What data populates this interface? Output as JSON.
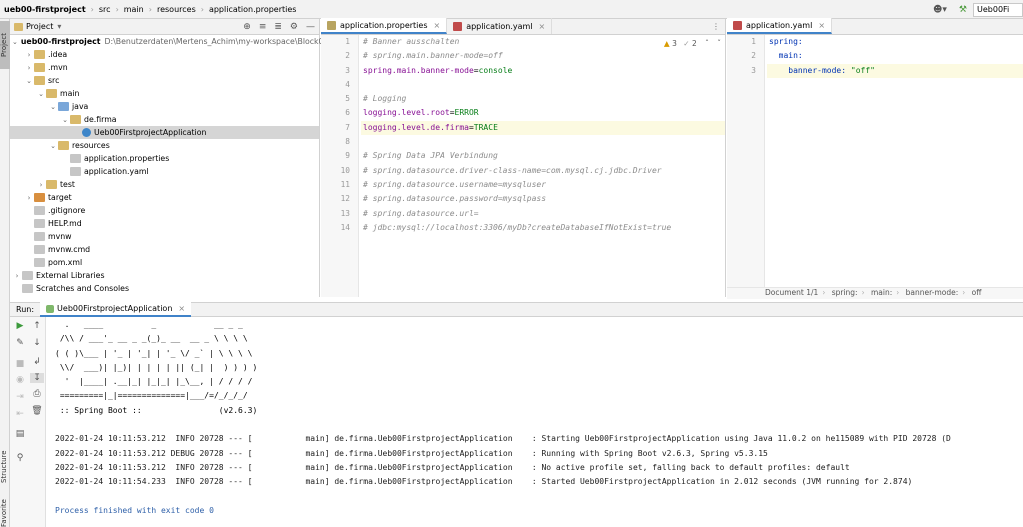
{
  "topbar": {
    "breadcrumbs": [
      "ueb00-firstproject",
      "src",
      "main",
      "resources",
      "application.properties"
    ],
    "run_config": "Ueb00Fi",
    "colors": {
      "accent": "#4083c9"
    }
  },
  "left_strip": {
    "tabs": [
      "Project",
      "Structure",
      "Favorites"
    ]
  },
  "project_panel": {
    "title": "Project",
    "tree": [
      {
        "label": "ueb00-firstproject",
        "path": "D:\\Benutzerdaten\\Mertens_Achim\\my-workspace\\Block07\\ue",
        "icon": "folder",
        "depth": 0,
        "expanded": true
      },
      {
        "label": ".idea",
        "icon": "folder",
        "depth": 1,
        "expanded": false
      },
      {
        "label": ".mvn",
        "icon": "folder",
        "depth": 1,
        "expanded": false
      },
      {
        "label": "src",
        "icon": "folder",
        "depth": 1,
        "expanded": true
      },
      {
        "label": "main",
        "icon": "folder",
        "depth": 2,
        "expanded": true
      },
      {
        "label": "java",
        "icon": "folder-blue",
        "depth": 3,
        "expanded": true
      },
      {
        "label": "de.firma",
        "icon": "folder",
        "depth": 4,
        "expanded": true
      },
      {
        "label": "Ueb00FirstprojectApplication",
        "icon": "class",
        "depth": 5,
        "selected": true
      },
      {
        "label": "resources",
        "icon": "folder",
        "depth": 3,
        "expanded": true
      },
      {
        "label": "application.properties",
        "icon": "file",
        "depth": 4
      },
      {
        "label": "application.yaml",
        "icon": "file",
        "depth": 4
      },
      {
        "label": "test",
        "icon": "folder",
        "depth": 2,
        "expanded": false
      },
      {
        "label": "target",
        "icon": "folder-orange",
        "depth": 1,
        "expanded": false
      },
      {
        "label": ".gitignore",
        "icon": "file",
        "depth": 1
      },
      {
        "label": "HELP.md",
        "icon": "file",
        "depth": 1
      },
      {
        "label": "mvnw",
        "icon": "file",
        "depth": 1
      },
      {
        "label": "mvnw.cmd",
        "icon": "file",
        "depth": 1
      },
      {
        "label": "pom.xml",
        "icon": "file",
        "depth": 1
      },
      {
        "label": "External Libraries",
        "icon": "lib",
        "depth": 0,
        "expanded": false
      },
      {
        "label": "Scratches and Consoles",
        "icon": "scratch",
        "depth": 0
      }
    ]
  },
  "editor_left": {
    "tabs": [
      {
        "label": "application.properties",
        "active": true
      },
      {
        "label": "application.yaml",
        "active": false
      }
    ],
    "inspection": {
      "warnings": "3",
      "weak": "2"
    },
    "lines": [
      {
        "n": "1",
        "parts": [
          {
            "t": "# Banner ausschalten",
            "c": "cm"
          }
        ]
      },
      {
        "n": "2",
        "parts": [
          {
            "t": "# spring.main.banner-mode=off",
            "c": "cm"
          }
        ]
      },
      {
        "n": "3",
        "parts": [
          {
            "t": "spring.main.banner-mode",
            "c": "key"
          },
          {
            "t": "=",
            "c": ""
          },
          {
            "t": "console",
            "c": "val"
          }
        ]
      },
      {
        "n": "4",
        "parts": []
      },
      {
        "n": "5",
        "parts": [
          {
            "t": "# Logging",
            "c": "cm"
          }
        ]
      },
      {
        "n": "6",
        "parts": [
          {
            "t": "logging.level.root",
            "c": "key"
          },
          {
            "t": "=",
            "c": ""
          },
          {
            "t": "ERROR",
            "c": "val"
          }
        ]
      },
      {
        "n": "7",
        "parts": [
          {
            "t": "logging.level.de.firma",
            "c": "key"
          },
          {
            "t": "=",
            "c": ""
          },
          {
            "t": "TRACE",
            "c": "val"
          }
        ],
        "highlight": true
      },
      {
        "n": "8",
        "parts": []
      },
      {
        "n": "9",
        "parts": [
          {
            "t": "# Spring Data JPA Verbindung",
            "c": "cm"
          }
        ]
      },
      {
        "n": "10",
        "parts": [
          {
            "t": "# spring.datasource.driver-class-name=com.mysql.cj.jdbc.Driver",
            "c": "cm"
          }
        ]
      },
      {
        "n": "11",
        "parts": [
          {
            "t": "# spring.datasource.username=mysqluser",
            "c": "cm"
          }
        ]
      },
      {
        "n": "12",
        "parts": [
          {
            "t": "# spring.datasource.password=mysqlpass",
            "c": "cm"
          }
        ]
      },
      {
        "n": "13",
        "parts": [
          {
            "t": "# spring.datasource.url=",
            "c": "cm"
          }
        ]
      },
      {
        "n": "14",
        "parts": [
          {
            "t": "# jdbc:mysql://localhost:3306/myDb?createDatabaseIfNotExist=true",
            "c": "cm"
          }
        ]
      }
    ]
  },
  "editor_right": {
    "tabs": [
      {
        "label": "application.yaml",
        "active": true
      }
    ],
    "lines": [
      {
        "n": "1",
        "parts": [
          {
            "t": "spring:",
            "c": "kw"
          }
        ]
      },
      {
        "n": "2",
        "parts": [
          {
            "t": "  main:",
            "c": "kw"
          }
        ]
      },
      {
        "n": "3",
        "parts": [
          {
            "t": "    banner-mode: ",
            "c": "kw"
          },
          {
            "t": "\"off\"",
            "c": "val"
          }
        ],
        "highlight": true
      }
    ],
    "breadcrumb": [
      "Document 1/1",
      "spring:",
      "main:",
      "banner-mode:",
      "off"
    ]
  },
  "run_panel": {
    "label": "Run:",
    "tab": "Ueb00FirstprojectApplication",
    "banner": [
      "  .   ____          _            __ _ _",
      " /\\\\ / ___'_ __ _ _(_)_ __  __ _ \\ \\ \\ \\",
      "( ( )\\___ | '_ | '_| | '_ \\/ _` | \\ \\ \\ \\",
      " \\\\/  ___)| |_)| | | | | || (_| |  ) ) ) )",
      "  '  |____| .__|_| |_|_| |_\\__, | / / / /",
      " =========|_|==============|___/=/_/_/_/",
      " :: Spring Boot ::                (v2.6.3)"
    ],
    "logs": [
      "2022-01-24 10:11:53.212  INFO 20728 --- [           main] de.firma.Ueb00FirstprojectApplication    : Starting Ueb00FirstprojectApplication using Java 11.0.2 on he115089 with PID 20728 (D",
      "2022-01-24 10:11:53.212 DEBUG 20728 --- [           main] de.firma.Ueb00FirstprojectApplication    : Running with Spring Boot v2.6.3, Spring v5.3.15",
      "2022-01-24 10:11:53.212  INFO 20728 --- [           main] de.firma.Ueb00FirstprojectApplication    : No active profile set, falling back to default profiles: default",
      "2022-01-24 10:11:54.233  INFO 20728 --- [           main] de.firma.Ueb00FirstprojectApplication    : Started Ueb00FirstprojectApplication in 2.012 seconds (JVM running for 2.874)"
    ],
    "exit": "Process finished with exit code 0"
  }
}
